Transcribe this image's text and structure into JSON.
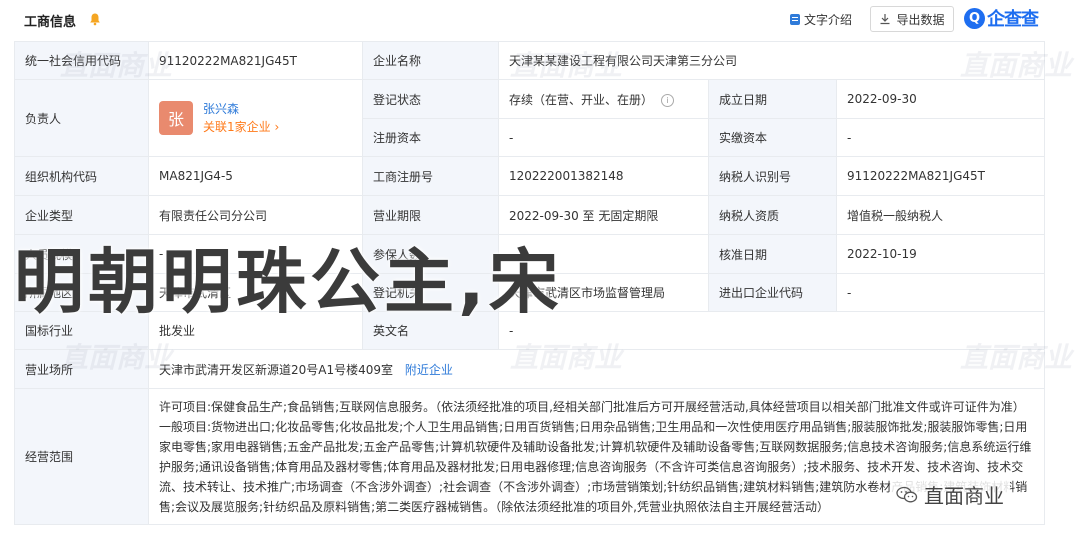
{
  "header": {
    "title": "工商信息",
    "intro_label": "文字介绍",
    "export_label": "导出数据",
    "logo_text": "企查查",
    "logo_mark": "Q"
  },
  "rows": {
    "credit_code": {
      "label": "统一社会信用代码",
      "value": "91120222MA821JG45T"
    },
    "company_name": {
      "label": "企业名称",
      "value": "天津某某建设工程有限公司天津第三分公司"
    },
    "legal_person": {
      "label": "负责人",
      "avatar": "张",
      "name": "张兴森",
      "related": "关联1家企业"
    },
    "reg_status": {
      "label": "登记状态",
      "value": "存续（在营、开业、在册）"
    },
    "est_date": {
      "label": "成立日期",
      "value": "2022-09-30"
    },
    "reg_capital": {
      "label": "注册资本",
      "value": "-"
    },
    "paid_capital": {
      "label": "实缴资本",
      "value": "-"
    },
    "org_code": {
      "label": "组织机构代码",
      "value": "MA821JG4-5"
    },
    "reg_no": {
      "label": "工商注册号",
      "value": "120222001382148"
    },
    "taxpayer_id": {
      "label": "纳税人识别号",
      "value": "91120222MA821JG45T"
    },
    "company_type": {
      "label": "企业类型",
      "value": "有限责任公司分公司"
    },
    "biz_term": {
      "label": "营业期限",
      "value": "2022-09-30 至 无固定期限"
    },
    "taxpayer_qual": {
      "label": "纳税人资质",
      "value": "增值税一般纳税人"
    },
    "staff_size": {
      "label": "人员规模",
      "value": "-"
    },
    "insured": {
      "label": "参保人数",
      "value": "-"
    },
    "approve_date": {
      "label": "核准日期",
      "value": "2022-10-19"
    },
    "region": {
      "label": "所属地区",
      "value": "天津市武清区"
    },
    "authority": {
      "label": "登记机关",
      "value": "天津市武清区市场监督管理局"
    },
    "import_export": {
      "label": "进出口企业代码",
      "value": "-"
    },
    "industry": {
      "label": "国标行业",
      "value": "批发业"
    },
    "english_name": {
      "label": "英文名",
      "value": "-"
    },
    "address": {
      "label": "营业场所",
      "value": "天津市武清开发区新源道20号A1号楼409室",
      "link": "附近企业"
    },
    "scope": {
      "label": "经营范围",
      "value": "许可项目:保健食品生产;食品销售;互联网信息服务。（依法须经批准的项目,经相关部门批准后方可开展经营活动,具体经营项目以相关部门批准文件或许可证件为准）一般项目:货物进出口;化妆品零售;化妆品批发;个人卫生用品销售;日用百货销售;日用杂品销售;卫生用品和一次性使用医疗用品销售;服装服饰批发;服装服饰零售;日用家电零售;家用电器销售;五金产品批发;五金产品零售;计算机软硬件及辅助设备批发;计算机软硬件及辅助设备零售;互联网数据服务;信息技术咨询服务;信息系统运行维护服务;通讯设备销售;体育用品及器材零售;体育用品及器材批发;日用电器修理;信息咨询服务（不含许可类信息咨询服务）;技术服务、技术开发、技术咨询、技术交流、技术转让、技术推广;市场调查（不含涉外调查）;社会调查（不含涉外调查）;市场营销策划;针纺织品销售;建筑材料销售;建筑防水卷材产品销售;建筑装饰材料销售;会议及展览服务;针纺织品及原料销售;第二类医疗器械销售。（除依法须经批准的项目外,凭营业执照依法自主开展经营活动）"
    }
  },
  "watermark": "直面商业",
  "overlay_text": "明朝明珠公主,宋",
  "wechat_label": "直面商业",
  "colors": {
    "accent": "#2f7bd9",
    "orange": "#ff7a1a",
    "label_bg": "#f3f6fb",
    "avatar": "#e98a6e",
    "logo": "#1e6ef0"
  }
}
